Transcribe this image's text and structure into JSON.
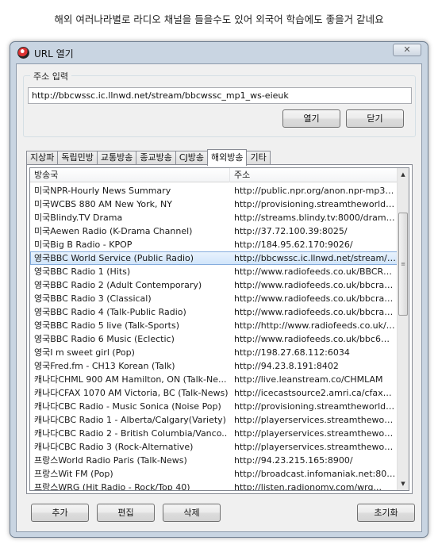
{
  "caption": "해외 여러나라별로 라디오 채널을 들을수도 있어 외국어 학습에도 좋을거 같네요",
  "window": {
    "title": "URL 열기",
    "close_icon_text": "✕"
  },
  "address": {
    "group_label": "주소 입력",
    "url_value": "http://bbcwssc.ic.llnwd.net/stream/bbcwssc_mp1_ws-eieuk",
    "open_label": "열기",
    "close_label": "닫기"
  },
  "tabs": [
    {
      "label": "지상파"
    },
    {
      "label": "독립민방"
    },
    {
      "label": "교통방송"
    },
    {
      "label": "종교방송"
    },
    {
      "label": "CJ방송"
    },
    {
      "label": "해외방송",
      "active": true
    },
    {
      "label": "기타"
    }
  ],
  "list": {
    "columns": [
      "방송국",
      "주소"
    ],
    "selected_index": 5,
    "rows": [
      [
        "미국NPR-Hourly News Summary",
        "http://public.npr.org/anon.npr-mp3/np..."
      ],
      [
        "미국WCBS 880 AM New York, NY",
        "http://provisioning.streamtheworld.co..."
      ],
      [
        "미국Blindy.TV Drama",
        "http://streams.blindy.tv:8000/drama.m..."
      ],
      [
        "미국Aewen Radio (K-Drama Channel)",
        "http://37.72.100.39:8025/"
      ],
      [
        "미국Big B Radio - KPOP",
        "http://184.95.62.170:9026/"
      ],
      [
        "영국BBC World Service (Public Radio)",
        "http://bbcwssc.ic.llnwd.net/stream/bbc..."
      ],
      [
        "영국BBC Radio 1 (Hits)",
        "http://www.radiofeeds.co.uk/BBCRadio..."
      ],
      [
        "영국BBC Radio 2 (Adult Contemporary)",
        "http://www.radiofeeds.co.uk/bbcradio..."
      ],
      [
        "영국BBC Radio 3 (Classical)",
        "http://www.radiofeeds.co.uk/bbcradio..."
      ],
      [
        "영국BBC Radio 4 (Talk-Public Radio)",
        "http://www.radiofeeds.co.uk/bbcradio..."
      ],
      [
        "영국BBC Radio 5 live (Talk-Sports)",
        "http://http://www.radiofeeds.co.uk/bbc..."
      ],
      [
        "영국BBC Radio 6 Music (Eclectic)",
        "http://www.radiofeeds.co.uk/bbc6musi..."
      ],
      [
        "영국I m sweet girl (Pop)",
        "http://198.27.68.112:6034"
      ],
      [
        "영국Fred.fm - CH13 Korean (Talk)",
        "http://94.23.8.191:8402"
      ],
      [
        "캐나다CHML 900 AM Hamilton, ON (Talk-Ne...",
        "http://live.leanstream.co/CHMLAM"
      ],
      [
        "캐나다CFAX 1070 AM Victoria, BC (Talk-News)",
        "http://icecastsource2.amri.ca/cfaxam-..."
      ],
      [
        "캐나다CBC Radio - Music Sonica (Noise Pop)",
        "http://provisioning.streamtheworld.co..."
      ],
      [
        "캐나다CBC Radio 1 - Alberta/Calgary(Variety)",
        "http://playerservices.streamtheworld.c..."
      ],
      [
        "캐나다CBC Radio 2 - British Columbia/Vanco...",
        "http://playerservices.streamtheworld.c..."
      ],
      [
        "캐나다CBC Radio 3 (Rock-Alternative)",
        "http://playerservices.streamtheworld.c..."
      ],
      [
        "프랑스World Radio Paris (Talk-News)",
        "http://94.23.215.165:8900/"
      ],
      [
        "프랑스Wit FM (Pop)",
        "http://broadcast.infomaniak.net:80/sta..."
      ],
      [
        "프랑스WRG (Hit Radio - Rock/Top 40)",
        "http://listen.radionomy.com/wrg..."
      ]
    ]
  },
  "scrollbar": {
    "up_arrow": "▲",
    "down_arrow": "▼",
    "grip": "≡"
  },
  "buttons": {
    "add": "추가",
    "edit": "편집",
    "delete": "삭제",
    "reset": "초기화"
  }
}
